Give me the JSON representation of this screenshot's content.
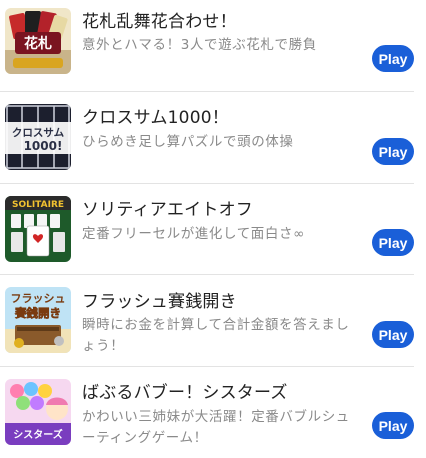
{
  "games": [
    {
      "title": "花札乱舞花合わせ！",
      "description": "意外とハマる！3人で遊ぶ花札で勝負",
      "play_label": "Play",
      "icon": "hanafuda-cards-icon"
    },
    {
      "title": "クロスサム1000！",
      "description": "ひらめき足し算パズルで頭の体操",
      "play_label": "Play",
      "icon": "cross-sum-grid-icon",
      "icon_text": [
        "クロスサム",
        "1000!"
      ]
    },
    {
      "title": "ソリティアエイトオフ",
      "description": "定番フリーセルが進化して面白さ∞",
      "play_label": "Play",
      "icon": "solitaire-cards-icon",
      "icon_text": "SOLITAIRE"
    },
    {
      "title": "フラッシュ賽銭開き",
      "description": "瞬時にお金を計算して合計金額を答えましょう！",
      "play_label": "Play",
      "icon": "offering-box-icon",
      "icon_text": [
        "フラッシュ",
        "賽銭開き"
      ]
    },
    {
      "title": "ばぶるバブー！シスターズ",
      "description": "かわいい三姉妹が大活躍！定番バブルシューティングゲーム！",
      "play_label": "Play",
      "icon": "bubble-sisters-icon",
      "icon_text": "シスターズ"
    }
  ],
  "colors": {
    "play_button": "#1a5fd8",
    "title_text": "#222222",
    "description_text": "#8a8a8a",
    "separator": "#e3e3e3"
  }
}
